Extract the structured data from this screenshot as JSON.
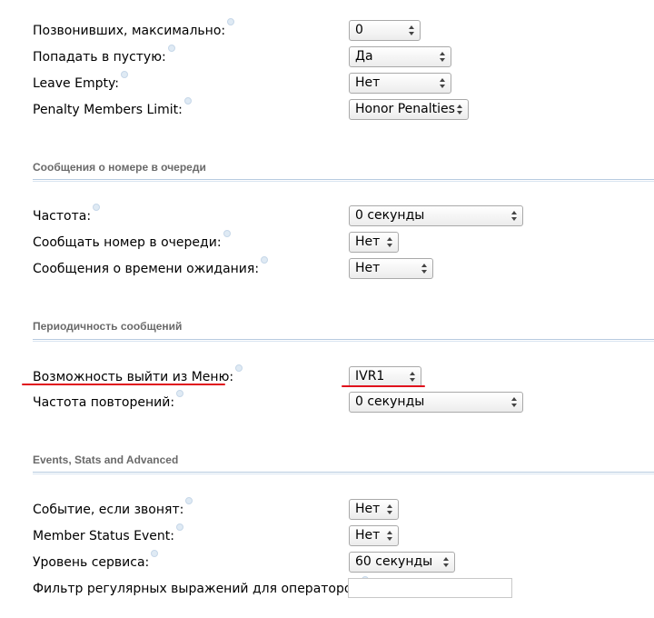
{
  "queue": {
    "callers_max": {
      "label": "Позвонивших, максимально:",
      "value": "0"
    },
    "join_empty": {
      "label": "Попадать в пустую:",
      "value": "Да"
    },
    "leave_empty": {
      "label": "Leave Empty:",
      "value": "Нет"
    },
    "penalty_members_limit": {
      "label": "Penalty Members Limit:",
      "value": "Honor Penalties"
    }
  },
  "position_announcements": {
    "title": "Сообщения о номере в очереди",
    "frequency": {
      "label": "Частота:",
      "value": "0 секунды"
    },
    "announce_position": {
      "label": "Сообщать номер в очереди:",
      "value": "Нет"
    },
    "announce_holdtime": {
      "label": "Сообщения о времени ожидания:",
      "value": "Нет"
    }
  },
  "periodic_announcements": {
    "title": "Периодичность сообщений",
    "ivr_break_out": {
      "label": "Возможность выйти из Меню:",
      "value": "IVR1"
    },
    "repeat_frequency": {
      "label": "Частота повторений:",
      "value": "0 секунды"
    }
  },
  "advanced": {
    "title": "Events, Stats and Advanced",
    "event_when_called": {
      "label": "Событие, если звонят:",
      "value": "Нет"
    },
    "member_status_event": {
      "label": "Member Status Event:",
      "value": "Нет"
    },
    "service_level": {
      "label": "Уровень сервиса:",
      "value": "60 секунды"
    },
    "agent_regex_filter": {
      "label": "Фильтр регулярных выражений для операторов",
      "value": ""
    }
  },
  "annotation_color": "#e0101c"
}
